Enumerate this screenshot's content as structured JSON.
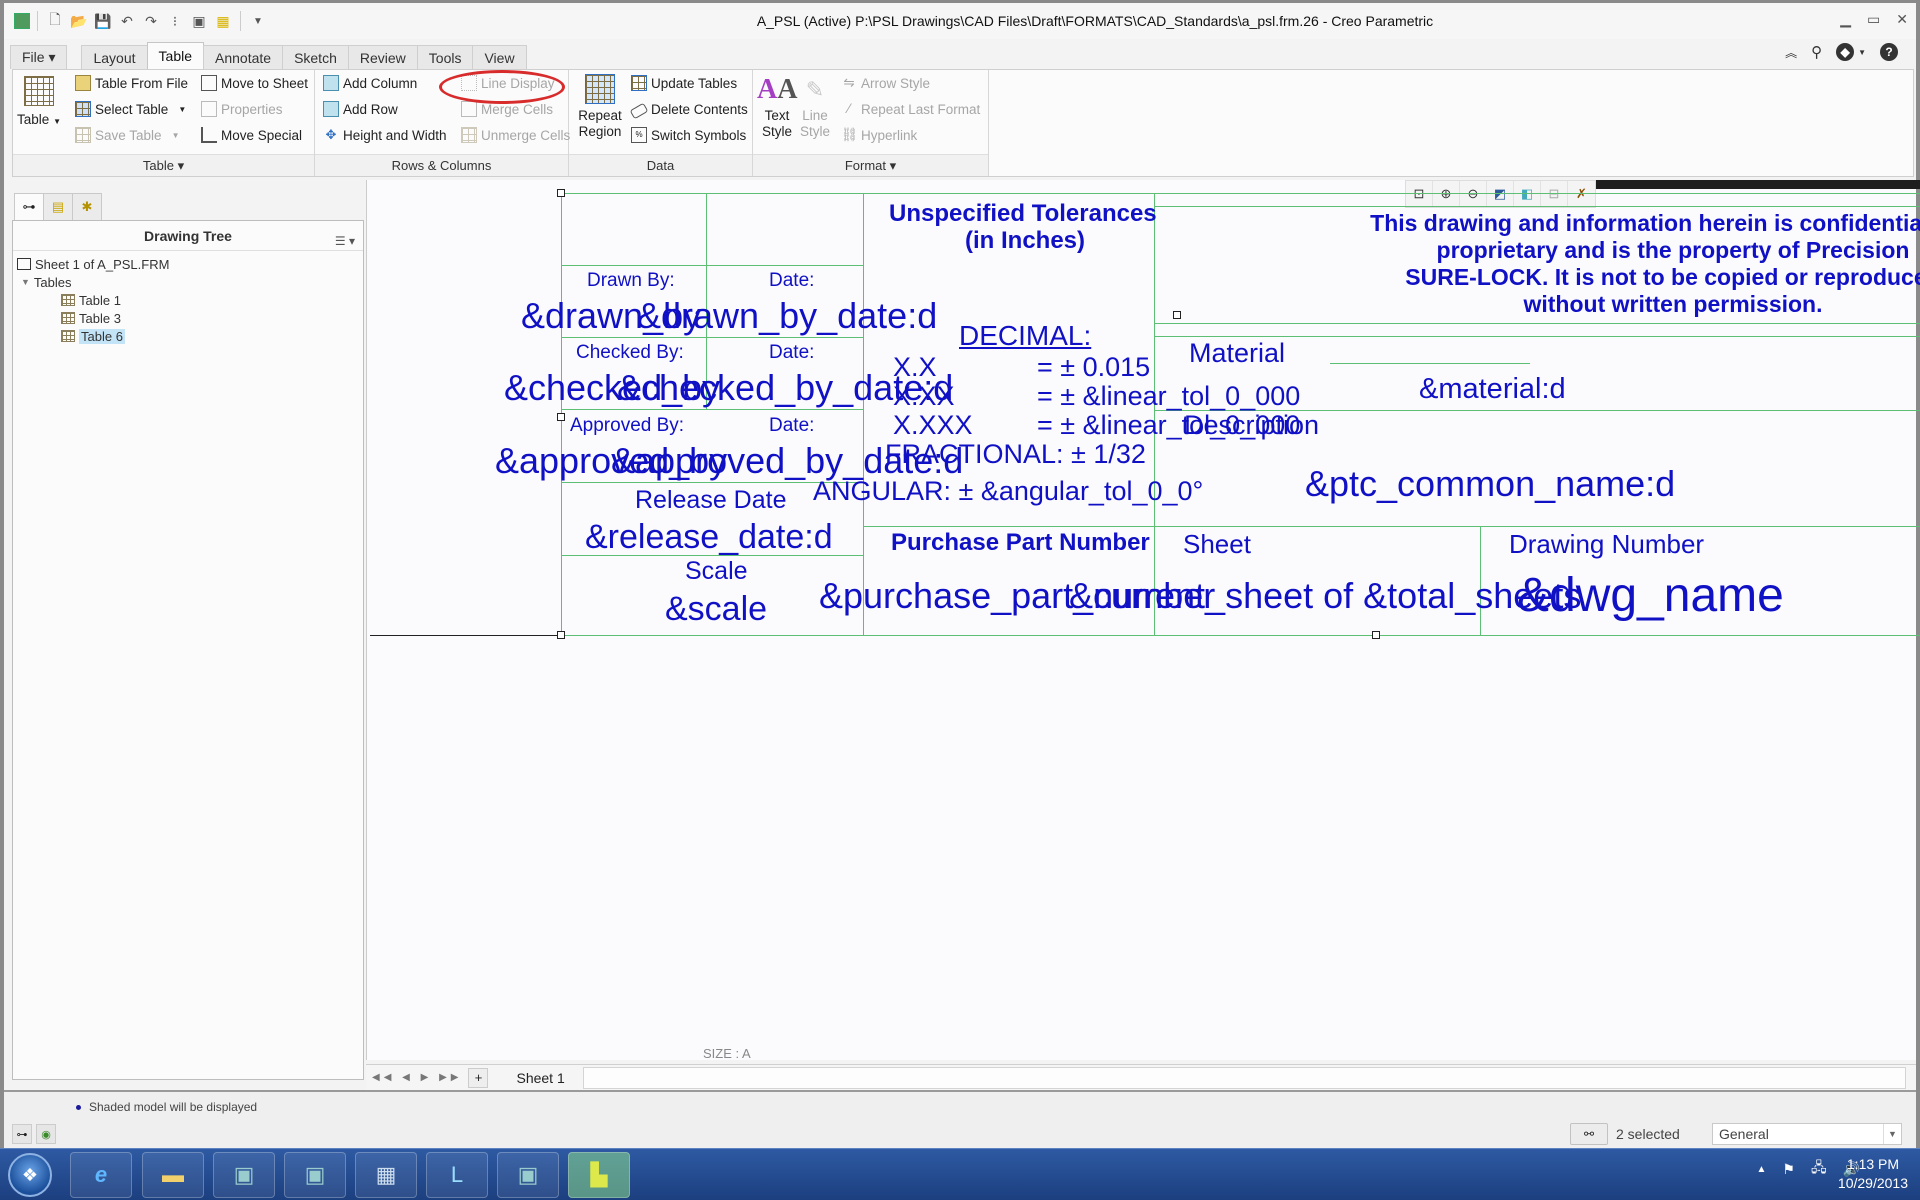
{
  "window": {
    "title": "A_PSL (Active) P:\\PSL Drawings\\CAD Files\\Draft\\FORMATS\\CAD_Standards\\a_psl.frm.26 - Creo Parametric",
    "controls": [
      "minimize-icon",
      "restore-icon",
      "close-icon"
    ]
  },
  "quick_access": [
    "app-icon",
    "new-icon",
    "open-icon",
    "save-icon",
    "undo-icon",
    "redo-icon",
    "regenerate-icon",
    "windows-icon",
    "close-file-icon",
    "customize-icon"
  ],
  "tabs": [
    {
      "label": "File ▾",
      "active": false
    },
    {
      "label": "Layout",
      "active": false
    },
    {
      "label": "Table",
      "active": true
    },
    {
      "label": "Annotate",
      "active": false
    },
    {
      "label": "Sketch",
      "active": false
    },
    {
      "label": "Review",
      "active": false
    },
    {
      "label": "Tools",
      "active": false
    },
    {
      "label": "View",
      "active": false
    }
  ],
  "ribbon": {
    "groups": {
      "table": {
        "label": "Table ▾",
        "big_button": "Table",
        "items": [
          {
            "label": "Table From File",
            "enabled": true
          },
          {
            "label": "Select Table",
            "enabled": true,
            "dropdown": true
          },
          {
            "label": "Save Table",
            "enabled": false,
            "dropdown": true
          },
          {
            "label": "Move to Sheet",
            "enabled": true
          },
          {
            "label": "Properties",
            "enabled": false
          },
          {
            "label": "Move Special",
            "enabled": true
          }
        ]
      },
      "rows_columns": {
        "label": "Rows & Columns",
        "items": [
          {
            "label": "Add Column",
            "enabled": true
          },
          {
            "label": "Add Row",
            "enabled": true
          },
          {
            "label": "Height and Width",
            "enabled": true
          },
          {
            "label": "Line Display",
            "enabled": false,
            "highlighted": true
          },
          {
            "label": "Merge Cells",
            "enabled": false
          },
          {
            "label": "Unmerge Cells",
            "enabled": false
          }
        ]
      },
      "data": {
        "label": "Data",
        "big_button_line1": "Repeat",
        "big_button_line2": "Region",
        "items": [
          {
            "label": "Update Tables",
            "enabled": true
          },
          {
            "label": "Delete Contents",
            "enabled": true
          },
          {
            "label": "Switch Symbols",
            "enabled": true
          }
        ]
      },
      "format": {
        "label": "Format ▾",
        "text_style_line1": "Text",
        "text_style_line2": "Style",
        "line_style_line1": "Line",
        "line_style_line2": "Style",
        "items": [
          {
            "label": "Arrow Style",
            "enabled": false
          },
          {
            "label": "Repeat Last Format",
            "enabled": false
          },
          {
            "label": "Hyperlink",
            "enabled": false
          }
        ]
      }
    }
  },
  "left_panel": {
    "title": "Drawing Tree",
    "tree": {
      "root": "Sheet 1 of A_PSL.FRM",
      "folder": "Tables",
      "items": [
        {
          "label": "Table 1",
          "selected": false
        },
        {
          "label": "Table 3",
          "selected": false
        },
        {
          "label": "Table 6",
          "selected": true
        }
      ]
    }
  },
  "drawing": {
    "drawn_by_label": "Drawn By:",
    "date_label_1": "Date:",
    "drawn_by_param": "&drawn_by",
    "drawn_by_date_param": "&drawn_by_date:d",
    "checked_by_label": "Checked By:",
    "date_label_2": "Date:",
    "checked_by_param": "&checked_by",
    "checked_by_date_param": "&checked_by_date:d",
    "approved_by_label": "Approved By:",
    "date_label_3": "Date:",
    "approved_by_param": "&approved_by",
    "approved_by_date_param": "&approved_by_date:d",
    "release_date_label": "Release Date",
    "release_date_param": "&release_date:d",
    "scale_label": "Scale",
    "scale_param": "&scale",
    "tolerances_title_1": "Unspecified Tolerances",
    "tolerances_title_2": "(in Inches)",
    "decimal_label": "DECIMAL:",
    "tol_rows": [
      {
        "key": "X.X",
        "value": "= ± 0.015"
      },
      {
        "key": "X.XX",
        "value": "= ± &linear_tol_0_000"
      },
      {
        "key": "X.XXX",
        "value": "= ± &linear_tol_0_000"
      }
    ],
    "fractional": "FRACTIONAL: ± 1/32",
    "angular": "ANGULAR: ± &angular_tol_0_0°",
    "confidential_1": "This drawing and information herein is confidential and",
    "confidential_2": "proprietary and is the property of Precision",
    "confidential_3": "SURE-LOCK.  It is not to be copied or reproduced",
    "confidential_4": "without written permission.",
    "material_label": "Material",
    "material_param": "&material:d",
    "description_label": "Description",
    "common_name_param": "&ptc_common_name:d",
    "purchase_part_label": "Purchase Part Number",
    "purchase_part_param": "&purchase_part_number",
    "sheet_label": "Sheet",
    "sheet_param": "&current_sheet of &total_sheets",
    "drawing_number_label": "Drawing Number",
    "drawing_number_param": "&dwg_name",
    "size_label": "SIZE : A"
  },
  "mini_toolbar": [
    "refit-icon",
    "zoom-in-icon",
    "zoom-out-icon",
    "repaint-icon",
    "display-style-icon",
    "annotation-display-icon",
    "datum-display-icon"
  ],
  "sheet_bar": {
    "nav": "◀◀ ◀ ▶ ▶▶",
    "add": "+",
    "sheet_tab": "Sheet 1"
  },
  "status_bar": {
    "message": "Shaded model will be displayed",
    "selection_count": "2 selected",
    "filter_value": "General"
  },
  "taskbar": {
    "apps": [
      "internet-explorer",
      "file-explorer",
      "window-app-1",
      "window-app-2",
      "calculator",
      "lync",
      "window-app-3",
      "creo-parametric"
    ],
    "time": "1:13 PM",
    "date": "10/29/2013"
  }
}
